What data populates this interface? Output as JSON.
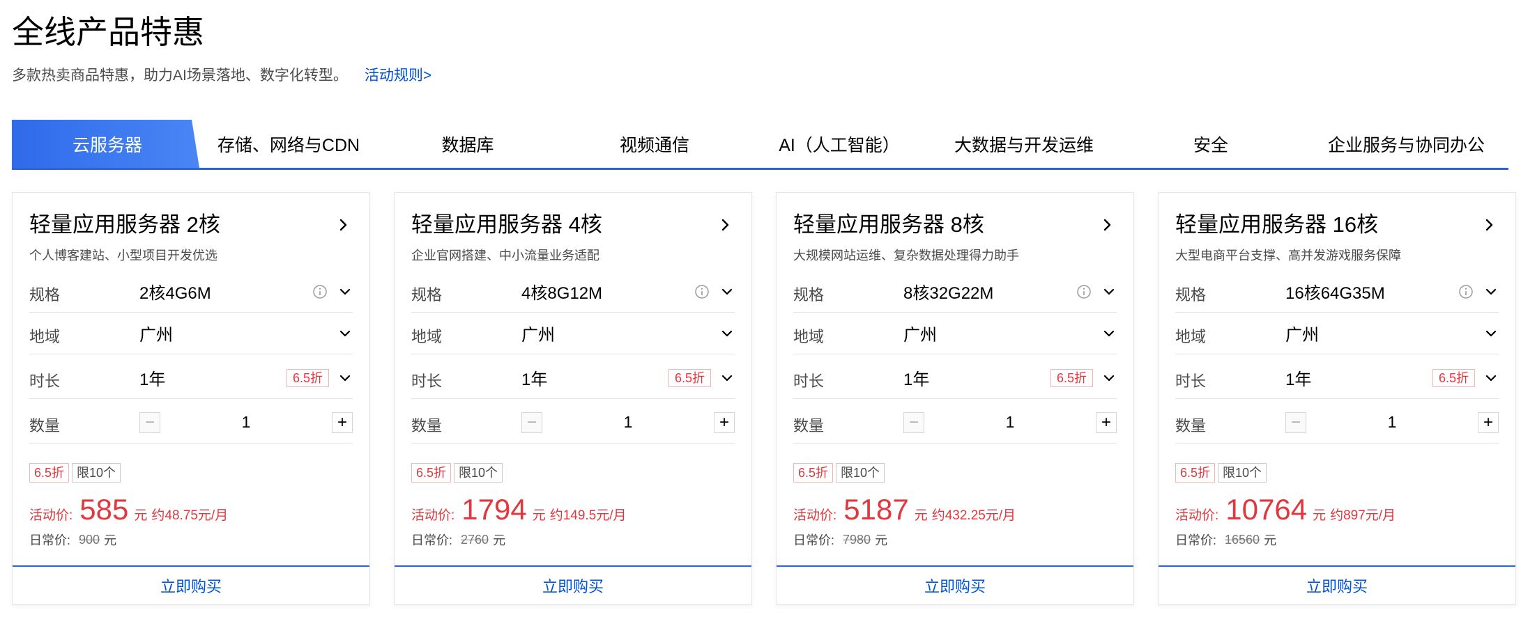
{
  "header": {
    "title": "全线产品特惠",
    "subtitle": "多款热卖商品特惠，助力AI场景落地、数字化转型。",
    "rules_link": "活动规则>"
  },
  "tabs": [
    {
      "label": "云服务器",
      "active": true
    },
    {
      "label": "存储、网络与CDN",
      "active": false
    },
    {
      "label": "数据库",
      "active": false
    },
    {
      "label": "视频通信",
      "active": false
    },
    {
      "label": "AI（人工智能）",
      "active": false
    },
    {
      "label": "大数据与开发运维",
      "active": false
    },
    {
      "label": "安全",
      "active": false
    },
    {
      "label": "企业服务与协同办公",
      "active": false
    }
  ],
  "labels": {
    "spec": "规格",
    "region": "地域",
    "duration": "时长",
    "quantity": "数量",
    "activity_price": "活动价:",
    "normal_price": "日常价:",
    "currency": "元",
    "buy": "立即购买",
    "limit_badge": "限10个"
  },
  "cards": [
    {
      "title": "轻量应用服务器 2核",
      "desc": "个人博客建站、小型项目开发优选",
      "spec": "2核4G6M",
      "region": "广州",
      "duration": "1年",
      "discount": "6.5折",
      "quantity": "1",
      "price": "585",
      "per_month": "约48.75元/月",
      "normal_price": "900"
    },
    {
      "title": "轻量应用服务器 4核",
      "desc": "企业官网搭建、中小流量业务适配",
      "spec": "4核8G12M",
      "region": "广州",
      "duration": "1年",
      "discount": "6.5折",
      "quantity": "1",
      "price": "1794",
      "per_month": "约149.5元/月",
      "normal_price": "2760"
    },
    {
      "title": "轻量应用服务器 8核",
      "desc": "大规模网站运维、复杂数据处理得力助手",
      "spec": "8核32G22M",
      "region": "广州",
      "duration": "1年",
      "discount": "6.5折",
      "quantity": "1",
      "price": "5187",
      "per_month": "约432.25元/月",
      "normal_price": "7980"
    },
    {
      "title": "轻量应用服务器 16核",
      "desc": "大型电商平台支撑、高并发游戏服务保障",
      "spec": "16核64G35M",
      "region": "广州",
      "duration": "1年",
      "discount": "6.5折",
      "quantity": "1",
      "price": "10764",
      "per_month": "约897元/月",
      "normal_price": "16560"
    }
  ],
  "colors": {
    "accent": "#0052d9",
    "price_red": "#e0383e",
    "tab_active_start": "#2f6bea",
    "tab_active_end": "#4a86f5"
  },
  "icons": {
    "card_arrow": "chevron-right-icon",
    "info": "info-circle-icon",
    "dropdown": "chevron-down-icon",
    "minus": "minus-icon",
    "plus": "plus-icon"
  }
}
